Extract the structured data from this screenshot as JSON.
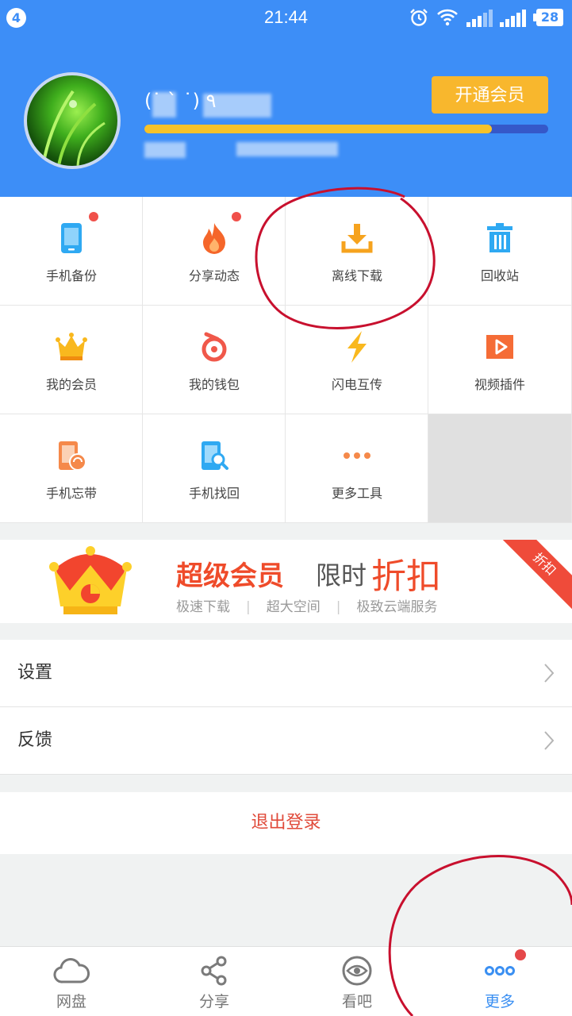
{
  "status_bar": {
    "notification_count": "4",
    "time": "21:44",
    "battery": "28",
    "icons": [
      "alarm-icon",
      "wifi-icon",
      "signal-icon",
      "signal-icon",
      "battery-icon"
    ]
  },
  "header": {
    "username": "(˙ ` ˙) ٩",
    "vip_button": "开通会员",
    "progress": 0.86,
    "colors": {
      "background": "#3d8ef7",
      "button": "#f8b72d",
      "progress_fill": "#f6c22a",
      "progress_track": "#3558c9"
    }
  },
  "grid": {
    "items": [
      {
        "label": "手机备份",
        "icon": "phone-backup-icon",
        "badge": true
      },
      {
        "label": "分享动态",
        "icon": "flame-icon",
        "badge": true
      },
      {
        "label": "离线下载",
        "icon": "download-icon",
        "badge": false
      },
      {
        "label": "回收站",
        "icon": "trash-icon",
        "badge": false
      },
      {
        "label": "我的会员",
        "icon": "crown-icon",
        "badge": false
      },
      {
        "label": "我的钱包",
        "icon": "wallet-icon",
        "badge": false
      },
      {
        "label": "闪电互传",
        "icon": "lightning-icon",
        "badge": false
      },
      {
        "label": "视频插件",
        "icon": "video-play-icon",
        "badge": false
      },
      {
        "label": "手机忘带",
        "icon": "phone-sync-icon",
        "badge": false
      },
      {
        "label": "手机找回",
        "icon": "phone-search-icon",
        "badge": false
      },
      {
        "label": "更多工具",
        "icon": "more-dots-icon",
        "badge": false
      }
    ]
  },
  "promo": {
    "title": "超级会员",
    "limit": "限时",
    "discount": "折扣",
    "features": [
      "极速下载",
      "超大空间",
      "极致云端服务"
    ],
    "ribbon": "折扣"
  },
  "menu": {
    "settings": "设置",
    "feedback": "反馈",
    "logout": "退出登录"
  },
  "tabbar": {
    "tabs": [
      {
        "label": "网盘",
        "icon": "cloud-icon"
      },
      {
        "label": "分享",
        "icon": "share-icon"
      },
      {
        "label": "看吧",
        "icon": "eye-icon"
      },
      {
        "label": "更多",
        "icon": "more-dots-icon",
        "active": true,
        "badge": true
      }
    ],
    "active_color": "#3a8ff2"
  }
}
